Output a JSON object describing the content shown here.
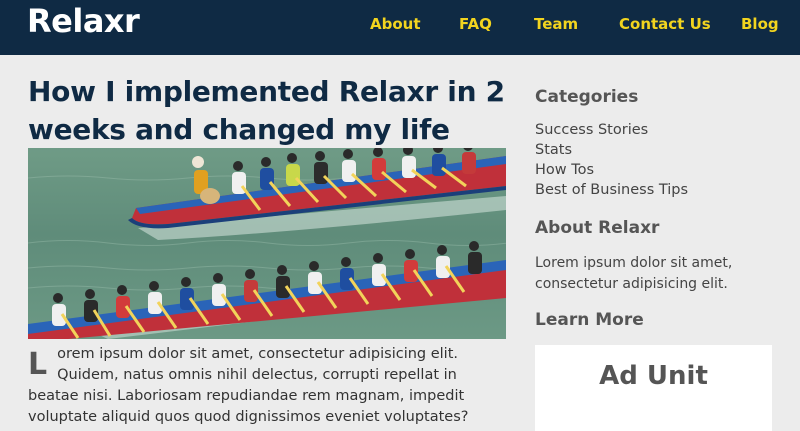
{
  "header": {
    "logo": "Relaxr",
    "nav": [
      "About",
      "FAQ",
      "Team",
      "Contact Us",
      "Blog"
    ]
  },
  "post": {
    "title": "How I implemented Relaxr in 2 weeks and changed my life",
    "dropcap": "L",
    "body": "orem ipsum dolor sit amet, consectetur adipisicing elit. Quidem, natus omnis nihil delectus, corrupti repellat in beatae nisi. Laboriosam repudiandae rem magnam, impedit voluptate aliquid quos quod dignissimos eveniet voluptates?"
  },
  "sidebar": {
    "categories_heading": "Categories",
    "categories": [
      "Success Stories",
      "Stats",
      "How Tos",
      "Best of Business Tips"
    ],
    "about_heading": "About Relaxr",
    "about_text": "Lorem ipsum dolor sit amet, consectetur adipisicing elit.",
    "learn_heading": "Learn More",
    "ad_label": "Ad Unit"
  },
  "colors": {
    "header_bg": "#0f2a44",
    "nav_text": "#f2d41f",
    "title_text": "#0f2a44",
    "page_bg": "#ececec"
  },
  "hero_image": "dragon-boat-race-photo"
}
